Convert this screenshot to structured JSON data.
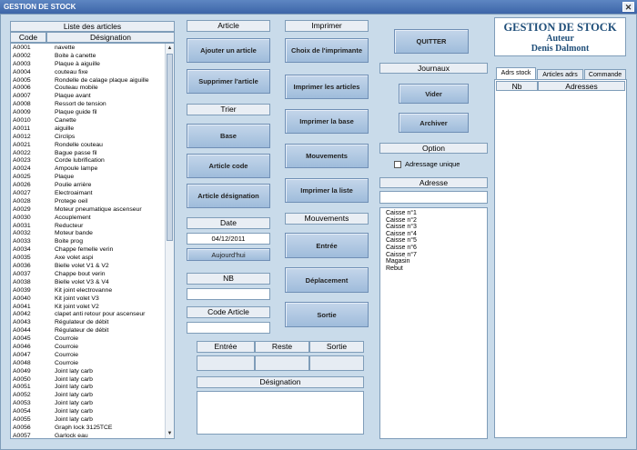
{
  "window": {
    "title": "GESTION DE STOCK",
    "close_glyph": "✕"
  },
  "articles": {
    "header": "Liste des articles",
    "col_code": "Code",
    "col_designation": "Désignation",
    "rows": [
      [
        "A0001",
        "navette"
      ],
      [
        "A0002",
        "Boite à canette"
      ],
      [
        "A0003",
        "Plaque à aiguille"
      ],
      [
        "A0004",
        "couteau fixe"
      ],
      [
        "A0005",
        "Rondelle de calage plaque aiguille"
      ],
      [
        "A0006",
        "Couteau mobile"
      ],
      [
        "A0007",
        "Plaque avant"
      ],
      [
        "A0008",
        "Ressort de tension"
      ],
      [
        "A0009",
        "Plaque guide fil"
      ],
      [
        "A0010",
        "Canette"
      ],
      [
        "A0011",
        "aiguille"
      ],
      [
        "A0012",
        "Circlips"
      ],
      [
        "A0021",
        "Rondelle couteau"
      ],
      [
        "A0022",
        "Bague passe fil"
      ],
      [
        "A0023",
        "Corde lubrification"
      ],
      [
        "A0024",
        "Ampoule lampe"
      ],
      [
        "A0025",
        "Plaque"
      ],
      [
        "A0026",
        "Poulie arrière"
      ],
      [
        "A0027",
        "Electroaimant"
      ],
      [
        "A0028",
        "Protege oeil"
      ],
      [
        "A0029",
        "Moteur pneumatique ascenseur"
      ],
      [
        "A0030",
        "Acouplement"
      ],
      [
        "A0031",
        "Reducteur"
      ],
      [
        "A0032",
        "Moteur bande"
      ],
      [
        "A0033",
        "Boite prog"
      ],
      [
        "A0034",
        "Chappe femelle verin"
      ],
      [
        "A0035",
        "Axe volet aspi"
      ],
      [
        "A0036",
        "Bielle volet V1 & V2"
      ],
      [
        "A0037",
        "Chappe bout verin"
      ],
      [
        "A0038",
        "Bielle volet V3 & V4"
      ],
      [
        "A0039",
        "Kit joint electrovanne"
      ],
      [
        "A0040",
        "Kit joint volet V3"
      ],
      [
        "A0041",
        "Kit joint volet V2"
      ],
      [
        "A0042",
        "clapet anti retour pour ascenseur"
      ],
      [
        "A0043",
        "Régulateur de débit"
      ],
      [
        "A0044",
        "Régulateur de débit"
      ],
      [
        "A0045",
        "Courroie"
      ],
      [
        "A0046",
        "Courroie"
      ],
      [
        "A0047",
        "Courroie"
      ],
      [
        "A0048",
        "Courroie"
      ],
      [
        "A0049",
        "Joint laty carb"
      ],
      [
        "A0050",
        "Joint laty carb"
      ],
      [
        "A0051",
        "Joint laty carb"
      ],
      [
        "A0052",
        "Joint laty carb"
      ],
      [
        "A0053",
        "Joint laty carb"
      ],
      [
        "A0054",
        "Joint laty carb"
      ],
      [
        "A0055",
        "Joint laty carb"
      ],
      [
        "A0056",
        "Graph lock 3125TCE"
      ],
      [
        "A0057",
        "Garlock eau"
      ]
    ]
  },
  "article_section": {
    "header": "Article",
    "add": "Ajouter un article",
    "delete": "Supprimer l'article"
  },
  "sort_section": {
    "header": "Trier",
    "base": "Base",
    "by_code": "Article code",
    "by_designation": "Article désignation"
  },
  "date_section": {
    "header": "Date",
    "value": "04/12/2011",
    "today": "Aujourd'hui"
  },
  "nb_section": {
    "header": "NB"
  },
  "code_section": {
    "header": "Code Article"
  },
  "stock_table": {
    "entree": "Entrée",
    "reste": "Reste",
    "sortie": "Sortie"
  },
  "designation_section": {
    "header": "Désignation"
  },
  "print_section": {
    "header": "Imprimer",
    "choose_printer": "Choix de l'imprimante",
    "print_articles": "Imprimer les articles",
    "print_base": "Imprimer la base",
    "movements": "Mouvements",
    "print_list": "Imprimer la liste"
  },
  "movements_section": {
    "header": "Mouvements",
    "entree": "Entrée",
    "deplacement": "Déplacement",
    "sortie": "Sortie"
  },
  "quit_button": "QUITTER",
  "journals_section": {
    "header": "Journaux",
    "empty": "Vider",
    "archive": "Archiver"
  },
  "option_section": {
    "header": "Option",
    "unique_address": "Adressage unique"
  },
  "address_section": {
    "header": "Adresse",
    "items": [
      "Caisse n°1",
      "Caisse n°2",
      "Caisse n°3",
      "Caisse n°4",
      "Caisse n°5",
      "Caisse n°6",
      "Caisse n°7",
      "Magasin",
      "Rebut"
    ]
  },
  "brand": {
    "title": "GESTION DE STOCK",
    "author_label": "Auteur",
    "author_name": "Denis Dalmont"
  },
  "tabs": {
    "adrs_stock": "Adrs stock",
    "articles_adrs": "Articles  adrs",
    "commande": "Commande"
  },
  "address_table": {
    "col_nb": "Nb",
    "col_adresses": "Adresses"
  },
  "colors": {
    "background": "#c9dbea",
    "button": "#a9c3df",
    "brand_title": "#1f4e79"
  },
  "icons": {
    "scroll_up": "▲",
    "scroll_down": "▼"
  }
}
